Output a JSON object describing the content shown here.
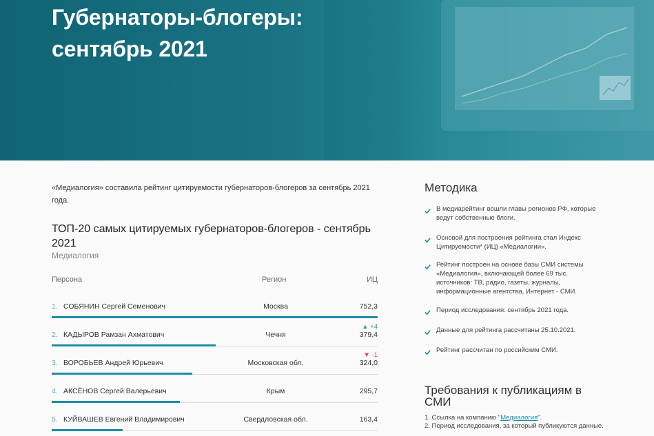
{
  "hero": {
    "title_line1": "Губернаторы-блогеры:",
    "title_line2": "сентябрь 2021"
  },
  "intro": "«Медиалогия» составила рейтинг цитируемости губернаторов-блогеров за сентябрь 2021 года.",
  "table": {
    "title": "ТОП-20 самых цитируемых губернаторов-блогеров - сентябрь 2021",
    "source": "Медиалогия",
    "headers": {
      "person": "Персона",
      "region": "Регион",
      "ic": "ИЦ"
    },
    "rows": [
      {
        "num": "1.",
        "name": "СОБЯНИН Сергей Семенович",
        "region": "Москва",
        "value": "752,3",
        "change": "",
        "change_dir": "",
        "share": 1.0
      },
      {
        "num": "2.",
        "name": "КАДЫРОВ Рамзан Ахматович",
        "region": "Чечня",
        "value": "379,4",
        "change": "▲ +4",
        "change_dir": "up",
        "share": 0.504
      },
      {
        "num": "3.",
        "name": "ВОРОБЬЕВ Андрей Юрьевич",
        "region": "Московская обл.",
        "value": "324,0",
        "change": "▼ -1",
        "change_dir": "down",
        "share": 0.431
      },
      {
        "num": "4.",
        "name": "АКСЁНОВ Сергей Валерьевич",
        "region": "Крым",
        "value": "295,7",
        "change": "",
        "change_dir": "",
        "share": 0.393
      },
      {
        "num": "5.",
        "name": "КУЙВАШЕВ Евгений Владимирович",
        "region": "Свердловская обл.",
        "value": "163,4",
        "change": "",
        "change_dir": "",
        "share": 0.217
      }
    ]
  },
  "sidebar": {
    "method_title": "Методика",
    "method_items": [
      "В медиарейтинг вошли главы регионов РФ, которые ведут собственные блоги.",
      "Основой для построения рейтинга стал Индекс Цитируемости* (ИЦ) «Медиалогии».",
      "Рейтинг построен на основе базы СМИ системы «Медиалогия», включающей более 69 тыс. источников: ТВ, радио, газеты, журналы, информационные агентства, Интернет - СМИ.",
      "Период исследования: сентябрь 2021 года.",
      "Данные для рейтинга рассчитаны 25.10.2021.",
      "Рейтинг рассчитан по российским СМИ."
    ],
    "req_title": "Требования к публикациям в СМИ",
    "req_items": [
      {
        "prefix": "1. Ссылка на компанию \"",
        "link": "Медиалогия",
        "suffix": "\"."
      },
      {
        "prefix": "2. Период исследования, за который публикуются данные.",
        "link": "",
        "suffix": ""
      }
    ]
  },
  "colors": {
    "accent": "#1d8ea2",
    "hero": "#106474",
    "up": "#3aa55a",
    "down": "#d9433e"
  }
}
